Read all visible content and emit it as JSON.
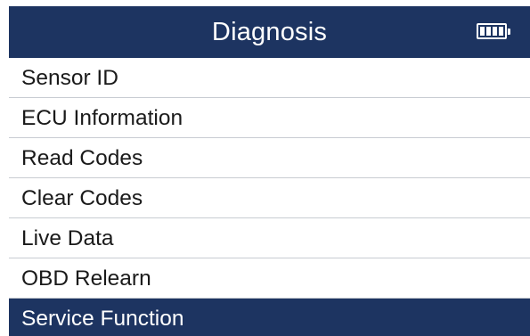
{
  "header": {
    "title": "Diagnosis",
    "battery_icon": "battery-icon",
    "battery_level": 1.0
  },
  "menu": {
    "selected_index": 6,
    "items": [
      {
        "label": "Sensor ID"
      },
      {
        "label": "ECU Information"
      },
      {
        "label": "Read Codes"
      },
      {
        "label": "Clear Codes"
      },
      {
        "label": "Live Data"
      },
      {
        "label": "OBD Relearn"
      },
      {
        "label": "Service Function"
      }
    ]
  },
  "colors": {
    "accent": "#1d3461",
    "text": "#1a1a1a",
    "background": "#ffffff"
  }
}
